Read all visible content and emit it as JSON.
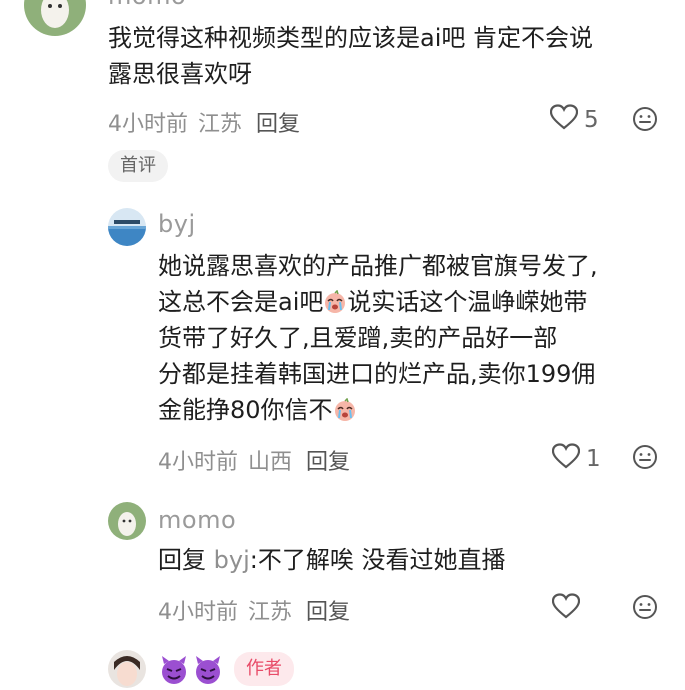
{
  "comment1": {
    "name_partial": "momo",
    "text_line1": "我觉得这种视频类型的应该是ai吧 肯定不会说",
    "text_line2": "露思很喜欢呀",
    "time": "4小时前",
    "location": "江苏",
    "reply_label": "回复",
    "like_count": "5",
    "tag": "首评"
  },
  "comment2": {
    "name": "byj",
    "line1": "她说露思喜欢的产品推广都被官旗号发了,",
    "line2a": "这总不会是ai吧",
    "line2b": "说实话这个温峥嵘她带",
    "line3": "货带了好久了,且爱蹭,卖的产品好一部",
    "line4": "分都是挂着韩国进口的烂产品,卖你199佣",
    "line5": "金能挣80你信不",
    "time": "4小时前",
    "location": "山西",
    "reply_label": "回复",
    "like_count": "1"
  },
  "comment3": {
    "name": "momo",
    "reply_prefix": "回复",
    "reply_target": "byj",
    "reply_text": ":不了解唉 没看过她直播",
    "time": "4小时前",
    "location": "江苏",
    "reply_label": "回复"
  },
  "comment4": {
    "author_tag": "作者"
  },
  "icons": {
    "like": "heart-outline-icon",
    "emoji": "smile-icon",
    "crying_emoji": "crying-face-emoji",
    "devil_emoji": "devil-face-emoji"
  },
  "colors": {
    "meta_gray": "#8f8f8f",
    "author_pink": "#e84b68"
  }
}
